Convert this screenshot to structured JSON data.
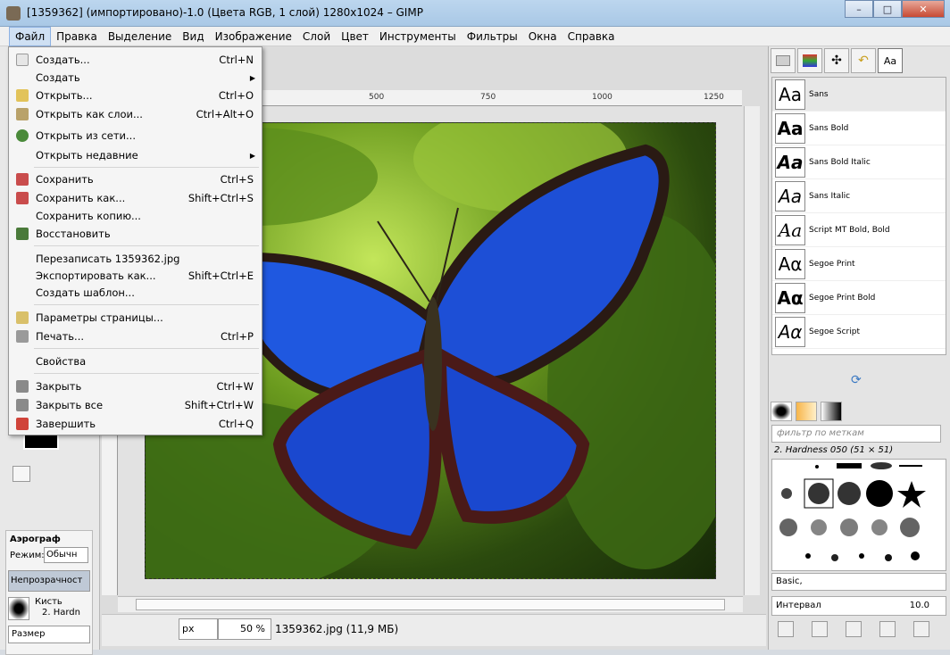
{
  "window": {
    "title": "[1359362] (импортировано)-1.0 (Цвета RGB, 1 слой) 1280x1024 – GIMP",
    "controls": [
      "–",
      "□",
      "✕"
    ]
  },
  "menubar": [
    "Файл",
    "Правка",
    "Выделение",
    "Вид",
    "Изображение",
    "Слой",
    "Цвет",
    "Инструменты",
    "Фильтры",
    "Окна",
    "Справка"
  ],
  "file_menu": {
    "items": [
      {
        "label": "Создать...",
        "shortcut": "Ctrl+N",
        "icon": "new-document-icon",
        "color": "#e6e6e6"
      },
      {
        "label": "Создать",
        "shortcut": "",
        "submenu": true,
        "icon": "",
        "color": ""
      },
      {
        "label": "Открыть...",
        "shortcut": "Ctrl+O",
        "icon": "folder-icon",
        "color": "#e2c35a"
      },
      {
        "label": "Открыть как слои...",
        "shortcut": "Ctrl+Alt+O",
        "icon": "open-layers-icon",
        "color": "#b9a26a"
      },
      {
        "label": "Открыть из сети...",
        "shortcut": "",
        "icon": "globe-icon",
        "color": "#4a8a3a"
      },
      {
        "label": "Открыть недавние",
        "shortcut": "",
        "submenu": true,
        "icon": "",
        "color": ""
      },
      {
        "label": "Сохранить",
        "shortcut": "Ctrl+S",
        "icon": "save-icon",
        "color": "#c94c4c"
      },
      {
        "label": "Сохранить как...",
        "shortcut": "Shift+Ctrl+S",
        "icon": "save-as-icon",
        "color": "#c94c4c"
      },
      {
        "label": "Сохранить копию...",
        "shortcut": "",
        "icon": "",
        "color": ""
      },
      {
        "label": "Восстановить",
        "shortcut": "",
        "icon": "revert-icon",
        "color": "#4a7a3a"
      },
      {
        "label": "Перезаписать 1359362.jpg",
        "shortcut": "",
        "icon": "",
        "color": ""
      },
      {
        "label": "Экспортировать как...",
        "shortcut": "Shift+Ctrl+E",
        "icon": "",
        "color": ""
      },
      {
        "label": "Создать шаблон...",
        "shortcut": "",
        "icon": "",
        "color": ""
      },
      {
        "label": "Параметры страницы...",
        "shortcut": "",
        "icon": "page-setup-icon",
        "color": "#d9c06a"
      },
      {
        "label": "Печать...",
        "shortcut": "Ctrl+P",
        "icon": "print-icon",
        "color": "#9a9a9a"
      },
      {
        "label": "Свойства",
        "shortcut": "",
        "icon": "",
        "color": ""
      },
      {
        "label": "Закрыть",
        "shortcut": "Ctrl+W",
        "icon": "close-icon",
        "color": "#8a8a8a"
      },
      {
        "label": "Закрыть все",
        "shortcut": "Shift+Ctrl+W",
        "icon": "close-all-icon",
        "color": "#8a8a8a"
      },
      {
        "label": "Завершить",
        "shortcut": "Ctrl+Q",
        "icon": "quit-icon",
        "color": "#d0443a"
      }
    ]
  },
  "ruler": {
    "ticks": [
      "500",
      "750",
      "1000",
      "1250"
    ]
  },
  "status": {
    "unit": "px",
    "zoom": "50 %",
    "file": "1359362.jpg (11,9 МБ)"
  },
  "tool_options": {
    "title": "Аэрограф",
    "mode_label": "Режим:",
    "mode_value": "Обычн",
    "opacity_label": "Непрозрачност",
    "brush_label": "Кисть",
    "brush_value": "2. Hardn",
    "size_label": "Размер"
  },
  "fonts_dock": {
    "fonts": [
      {
        "preview": "Aa",
        "name": "Sans"
      },
      {
        "preview": "Aa",
        "name": "Sans Bold"
      },
      {
        "preview": "Aa",
        "name": "Sans Bold Italic"
      },
      {
        "preview": "Aa",
        "name": "Sans Italic"
      },
      {
        "preview": "Aa",
        "name": "Script MT Bold, Bold"
      },
      {
        "preview": "Aα",
        "name": "Segoe Print"
      },
      {
        "preview": "Aα",
        "name": "Segoe Print Bold"
      },
      {
        "preview": "Aα",
        "name": "Segoe Script"
      }
    ],
    "tab_label": "Aa"
  },
  "brushes_dock": {
    "filter_placeholder": "фильтр по меткам",
    "brush_name": "2. Hardness 050 (51 × 51)",
    "preset": "Basic,",
    "interval_label": "Интервал",
    "interval_value": "10.0"
  },
  "colors": {
    "accent": "#cfe0f3",
    "butterfly_blue": "#1f5ee0",
    "leaf_green": "#4d7d1c"
  }
}
